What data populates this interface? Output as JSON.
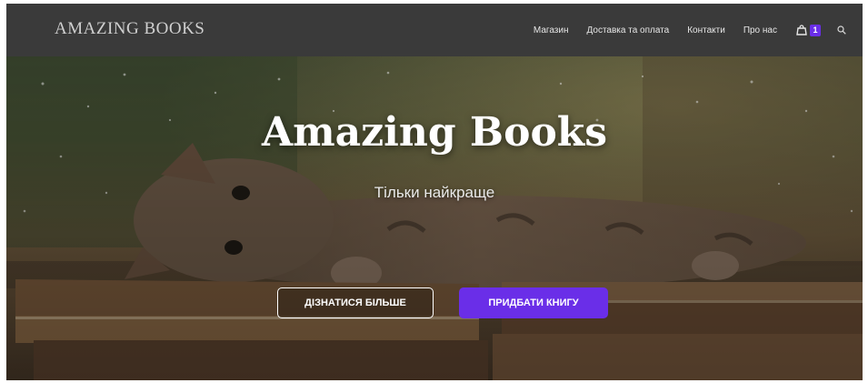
{
  "header": {
    "logo": "AMAZING BOOKS",
    "nav": [
      {
        "label": "Магазин"
      },
      {
        "label": "Доставка та оплата"
      },
      {
        "label": "Контакти"
      },
      {
        "label": "Про нас"
      }
    ],
    "cart_count": "1"
  },
  "hero": {
    "title": "Amazing Books",
    "subtitle": "Тільки найкраще",
    "buttons": {
      "learn_more": "ДІЗНАТИСЯ БІЛЬШЕ",
      "buy_book": "ПРИДБАТИ КНИГУ"
    }
  },
  "icons": {
    "cart": "shopping-bag-icon",
    "search": "search-icon"
  },
  "colors": {
    "header_bg": "#3a3a3a",
    "accent": "#6a2ee8",
    "text_light": "#ffffff"
  }
}
